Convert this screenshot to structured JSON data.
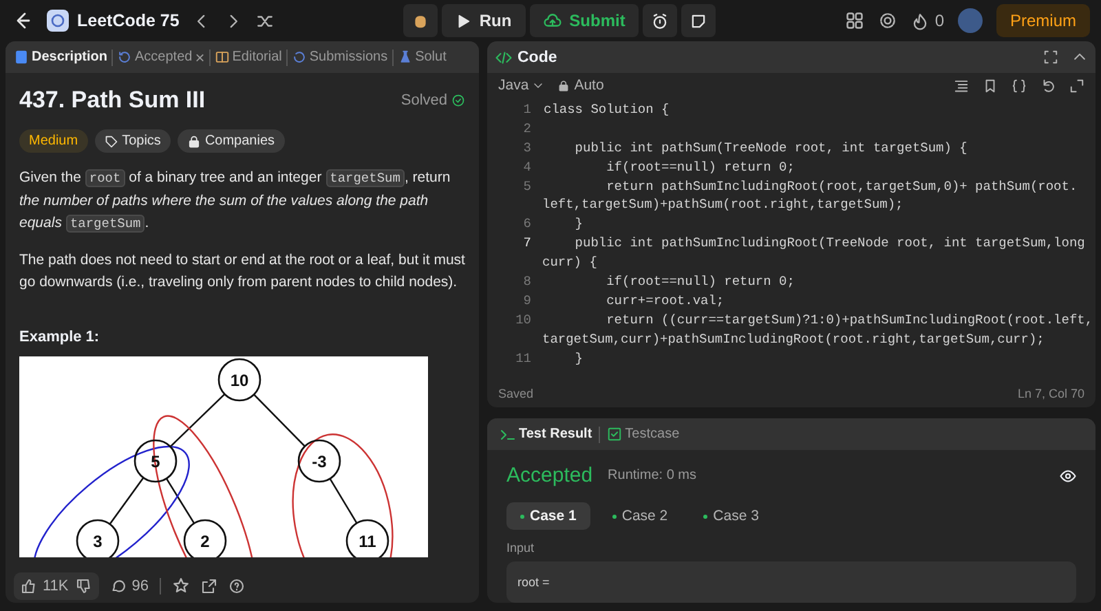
{
  "top_bar": {
    "list_title": "LeetCode 75",
    "run_label": "Run",
    "submit_label": "Submit",
    "streak_count": "0",
    "premium_label": "Premium"
  },
  "description_panel": {
    "tabs": [
      {
        "kind": "description",
        "label": "Description",
        "selected": true
      },
      {
        "kind": "accepted",
        "label": "Accepted",
        "selected": false,
        "close_label": "×"
      },
      {
        "kind": "editorial",
        "label": "Editorial",
        "selected": false
      },
      {
        "kind": "submissions",
        "label": "Submissions",
        "selected": false
      },
      {
        "kind": "solutions",
        "label": "Solut",
        "selected": false
      }
    ],
    "title": "437. Path Sum III",
    "status": "Solved",
    "tags": [
      {
        "kind": "difficulty",
        "label": "Medium"
      },
      {
        "kind": "topics",
        "label": "Topics"
      },
      {
        "kind": "companies",
        "label": "Companies"
      }
    ],
    "paragraphs": [
      [
        {
          "kind": "text",
          "text": "Given the "
        },
        {
          "kind": "code",
          "text": "root"
        },
        {
          "kind": "text",
          "text": " of a binary tree and an integer "
        },
        {
          "kind": "code",
          "text": "targetSum"
        },
        {
          "kind": "text",
          "text": ", return "
        },
        {
          "kind": "italic",
          "text": "the number of paths where the sum of the values along the path equals"
        },
        {
          "kind": "code",
          "text": "targetSum"
        },
        {
          "kind": "text",
          "text": "."
        }
      ],
      [
        {
          "kind": "text",
          "text": "The path does not need to start or end at the root or a leaf, but it must go downwards (i.e., traveling only from parent nodes to child nodes)."
        }
      ]
    ],
    "example_heading": "Example 1:",
    "example_tree": {
      "label": "10",
      "children": [
        {
          "label": "5",
          "children": [
            {
              "label": "3"
            },
            {
              "label": "2"
            }
          ]
        },
        {
          "label": "-3",
          "children": [
            {
              "label": "11"
            }
          ]
        }
      ]
    },
    "footer": {
      "likes": "11K",
      "comments": "96"
    }
  },
  "code_panel": {
    "title": "Code",
    "language": "Java",
    "mode": "Auto",
    "lines": [
      {
        "number": "1",
        "current": false,
        "text": [
          "class Solution {"
        ]
      },
      {
        "number": "2",
        "current": false
      },
      {
        "number": "3",
        "current": false,
        "text": [
          "    public int pathSum(TreeNode root, int targetSum) {"
        ]
      },
      {
        "number": "4",
        "current": false,
        "text": [
          "        if(root==null) return 0;"
        ]
      },
      {
        "number": "5",
        "current": false,
        "text": [
          "        return pathSumIncludingRoot(root,targetSum,0)+ pathSum(root.",
          "left,targetSum)+pathSum(root.right,targetSum);"
        ]
      },
      {
        "number": "6",
        "current": false,
        "text": [
          "    }"
        ]
      },
      {
        "number": "7",
        "current": true,
        "text": [
          "    public int pathSumIncludingRoot(TreeNode root, int targetSum,long",
          "curr) {"
        ]
      },
      {
        "number": "8",
        "current": false,
        "text": [
          "        if(root==null) return 0;"
        ]
      },
      {
        "number": "9",
        "current": false,
        "text": [
          "        curr+=root.val;"
        ]
      },
      {
        "number": "10",
        "current": false,
        "text": [
          "        return ((curr==targetSum)?1:0)+pathSumIncludingRoot(root.left,",
          "targetSum,curr)+pathSumIncludingRoot(root.right,targetSum,curr);"
        ]
      },
      {
        "number": "11",
        "current": false,
        "text": [
          "    }"
        ]
      }
    ],
    "status": "Saved",
    "cursor": "Ln 7, Col 70"
  },
  "test_panel": {
    "tabs": [
      {
        "kind": "result",
        "label": "Test Result",
        "selected": true
      },
      {
        "kind": "testcase",
        "label": "Testcase",
        "selected": false
      }
    ],
    "verdict": "Accepted",
    "runtime": "Runtime: 0 ms",
    "cases": [
      {
        "label": "Case 1",
        "selected": true
      },
      {
        "label": "Case 2",
        "selected": false
      },
      {
        "label": "Case 3",
        "selected": false
      }
    ],
    "input_label": "Input",
    "input_value": "root ="
  }
}
